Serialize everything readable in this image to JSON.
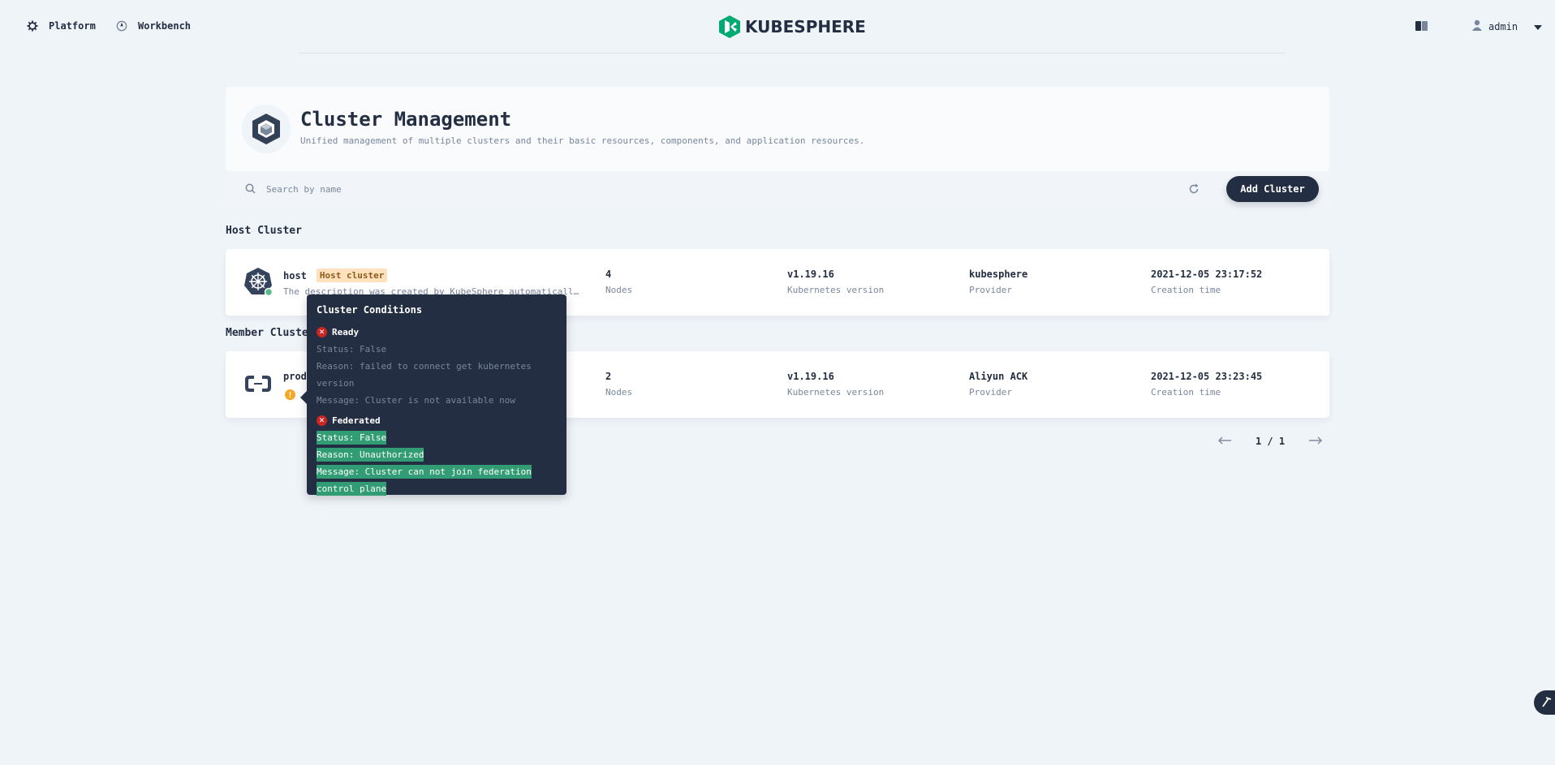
{
  "nav": {
    "platform_label": "Platform",
    "workbench_label": "Workbench",
    "logo_text": "KUBESPHERE",
    "user_name": "admin"
  },
  "header": {
    "title": "Cluster Management",
    "description": "Unified management of multiple clusters and their basic resources, components, and application resources."
  },
  "toolbar": {
    "search_placeholder": "Search by name",
    "add_button_label": "Add Cluster"
  },
  "sections": {
    "host_title": "Host Cluster",
    "member_title": "Member Clusters"
  },
  "host_cluster": {
    "name": "host",
    "tag": "Host cluster",
    "description": "The description was created by KubeSphere automatically. It is recommended that you use the Host Cluster to manage clusters only",
    "nodes_value": "4",
    "nodes_label": "Nodes",
    "version_value": "v1.19.16",
    "version_label": "Kubernetes version",
    "provider_value": "kubesphere",
    "provider_label": "Provider",
    "created_value": "2021-12-05 23:17:52",
    "created_label": "Creation time"
  },
  "member_cluster": {
    "name": "produ",
    "nodes_value": "2",
    "nodes_label": "Nodes",
    "version_value": "v1.19.16",
    "version_label": "Kubernetes version",
    "provider_value": "Aliyun ACK",
    "provider_label": "Provider",
    "created_value": "2021-12-05 23:23:45",
    "created_label": "Creation time"
  },
  "pagination": {
    "text": "1 / 1"
  },
  "tooltip": {
    "title": "Cluster Conditions",
    "ready": {
      "name": "Ready",
      "status": "Status: False",
      "reason": "Reason: failed to connect get kubernetes version",
      "message": "Message: Cluster is not available now"
    },
    "federated": {
      "name": "Federated",
      "status": "Status: False",
      "reason": "Reason: Unauthorized",
      "message": "Message: Cluster can not join federation control plane"
    }
  },
  "colors": {
    "background": "#eff4f9",
    "dark": "#242e42",
    "accent_green": "#329d74",
    "error_red": "#ca2621",
    "warning_orange": "#f5a623",
    "host_tag_bg": "#ffe1be"
  }
}
